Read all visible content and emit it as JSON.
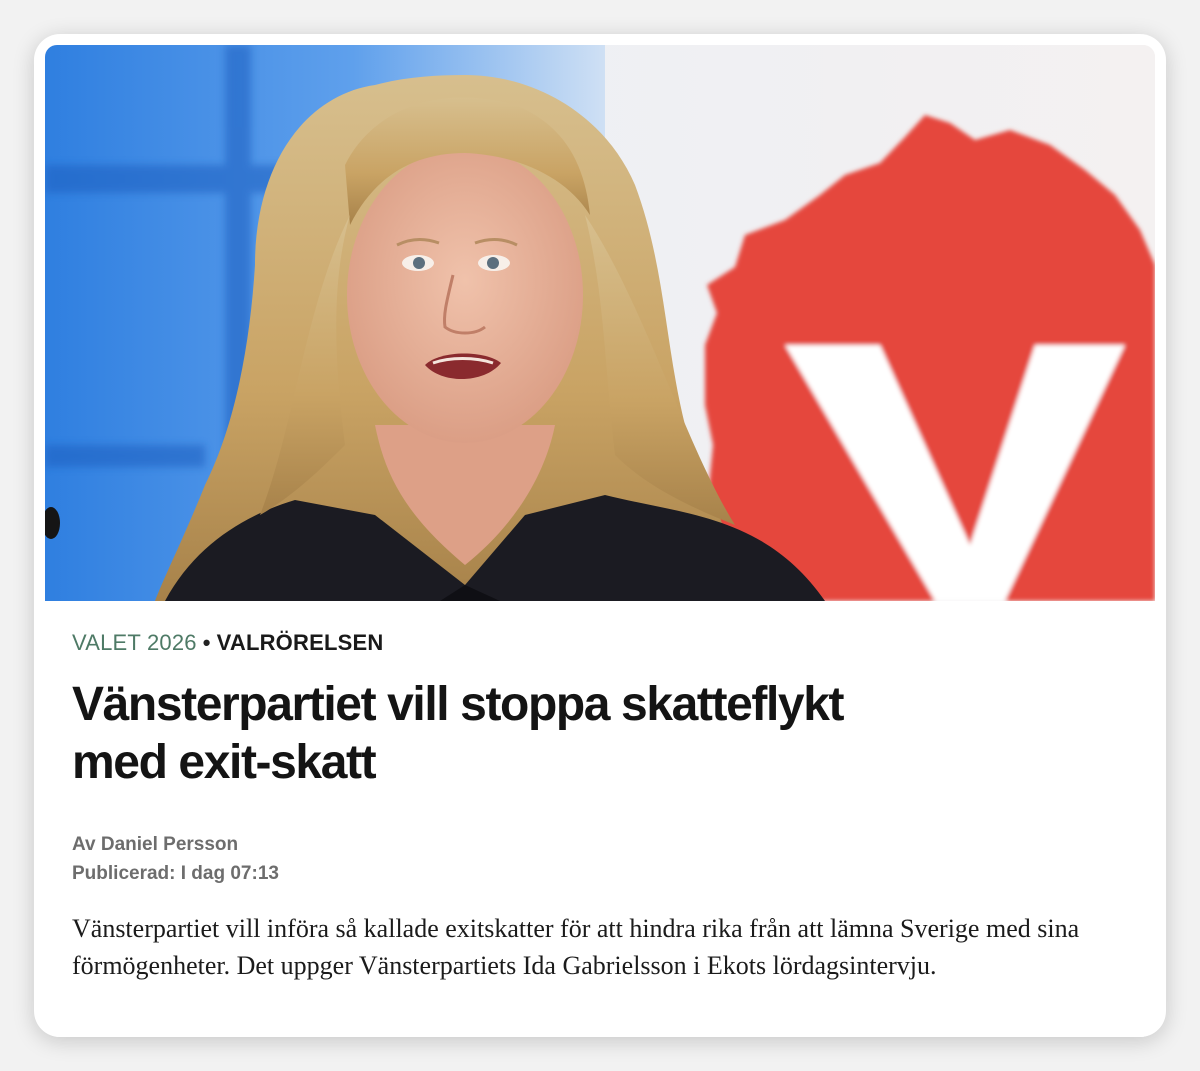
{
  "article": {
    "hero_image": {
      "subject": "photo",
      "logo_letter": "V",
      "colors": {
        "background_blue": "#3d86e2",
        "party_red": "#e5473c",
        "jacket": "#1b1b22",
        "hair": "#d8b978"
      }
    },
    "kicker": {
      "section": "VALET 2026",
      "separator": "•",
      "subsection": "VALRÖRELSEN"
    },
    "headline": "Vänsterpartiet vill stoppa skatteflykt med exit-skatt",
    "byline": "Av Daniel Persson",
    "published": "Publicerad: I dag 07:13",
    "lead": "Vänsterpartiet vill införa så kallade exitskatter för att hindra rika från att lämna Sverige med sina förmögenheter. Det uppger Vänsterpartiets Ida Gabrielsson i Ekots lördagsintervju."
  },
  "colors": {
    "section_green": "#4e7a66",
    "headline": "#141414",
    "meta_gray": "#6d6d6d"
  }
}
